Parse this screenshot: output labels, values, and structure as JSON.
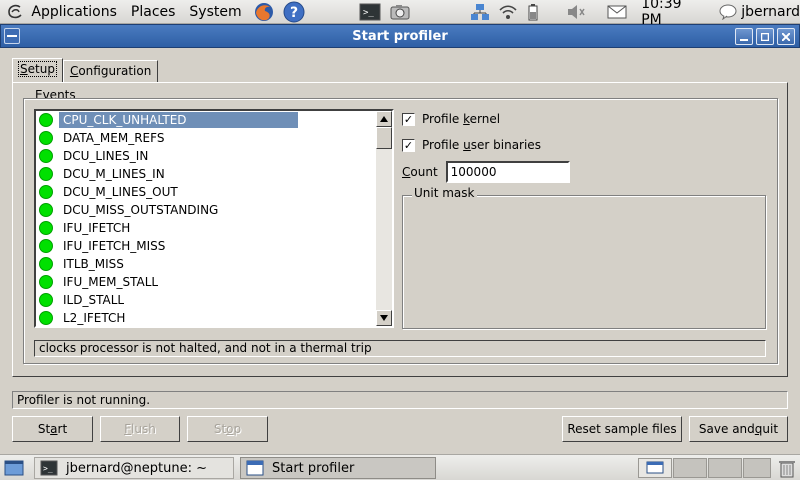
{
  "top_panel": {
    "menus": [
      "Applications",
      "Places",
      "System"
    ],
    "clock": "10:39 PM",
    "user": "jbernard"
  },
  "window": {
    "title": "Start profiler"
  },
  "tabs": [
    {
      "label": "Setup",
      "underline": "S",
      "rest": "etup"
    },
    {
      "label": "Configuration",
      "underline": "C",
      "rest": "onfiguration"
    }
  ],
  "events": {
    "legend": "Events",
    "items": [
      "CPU_CLK_UNHALTED",
      "DATA_MEM_REFS",
      "DCU_LINES_IN",
      "DCU_M_LINES_IN",
      "DCU_M_LINES_OUT",
      "DCU_MISS_OUTSTANDING",
      "IFU_IFETCH",
      "IFU_IFETCH_MISS",
      "ITLB_MISS",
      "IFU_MEM_STALL",
      "ILD_STALL",
      "L2_IFETCH"
    ],
    "selected_index": 0,
    "description": "clocks processor is not halted, and not in a thermal trip"
  },
  "options": {
    "profile_kernel": {
      "pre": "Profile ",
      "u": "k",
      "post": "ernel",
      "checked": "✓"
    },
    "profile_user": {
      "pre": "Profile ",
      "u": "u",
      "post": "ser binaries",
      "checked": "✓"
    },
    "count_label": {
      "u": "C",
      "post": "ount"
    },
    "count_value": "100000",
    "unit_mask_legend": "Unit mask"
  },
  "status": "Profiler is not running.",
  "buttons": {
    "start": {
      "pre": "St",
      "u": "a",
      "post": "rt"
    },
    "flush": {
      "pre": "",
      "u": "F",
      "post": "lush"
    },
    "stop": {
      "pre": "St",
      "u": "o",
      "post": "p"
    },
    "reset": "Reset sample files",
    "save_quit": {
      "pre": "Save and ",
      "u": "q",
      "post": "uit"
    }
  },
  "taskbar": {
    "terminal": "jbernard@neptune: ~",
    "profiler": "Start profiler"
  }
}
